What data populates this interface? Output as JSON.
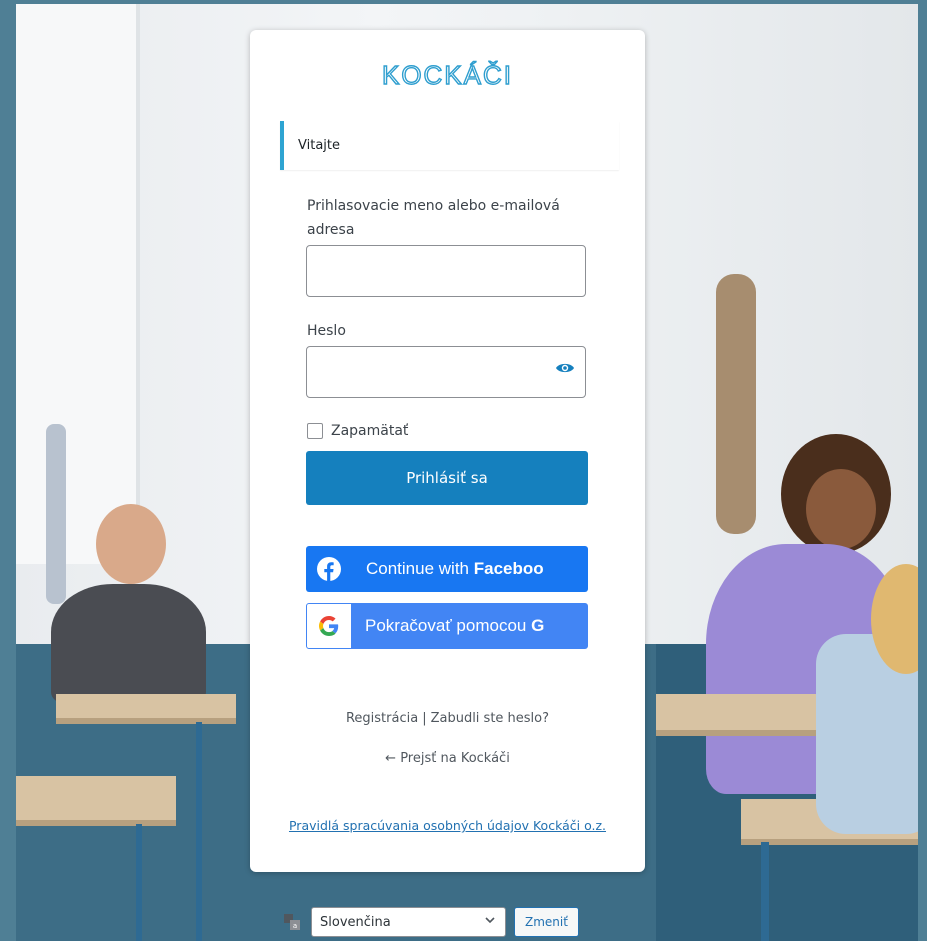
{
  "brand": {
    "logo_text": "KOCKÁČI",
    "accent_color": "#1580be"
  },
  "login": {
    "welcome": "Vitajte",
    "username_label": "Prihlasovacie meno alebo e-mailová adresa",
    "username_value": "",
    "password_label": "Heslo",
    "password_value": "",
    "remember_label": "Zapamätať",
    "submit_label": "Prihlásiť sa"
  },
  "social": {
    "facebook_prefix": "Continue with ",
    "facebook_bold": "Faceboo",
    "facebook_color": "#1877f2",
    "google_prefix": "Pokračovať pomocou ",
    "google_bold": "G",
    "google_color": "#4285f4"
  },
  "links": {
    "register": "Registrácia",
    "separator": "|",
    "lost_password": "Zabudli ste heslo?",
    "back_to_site": "← Prejsť na Kockáči",
    "privacy": "Pravidlá spracúvania osobných údajov Kockáči o.z."
  },
  "language": {
    "selected": "Slovenčina",
    "change_label": "Zmeniť"
  }
}
